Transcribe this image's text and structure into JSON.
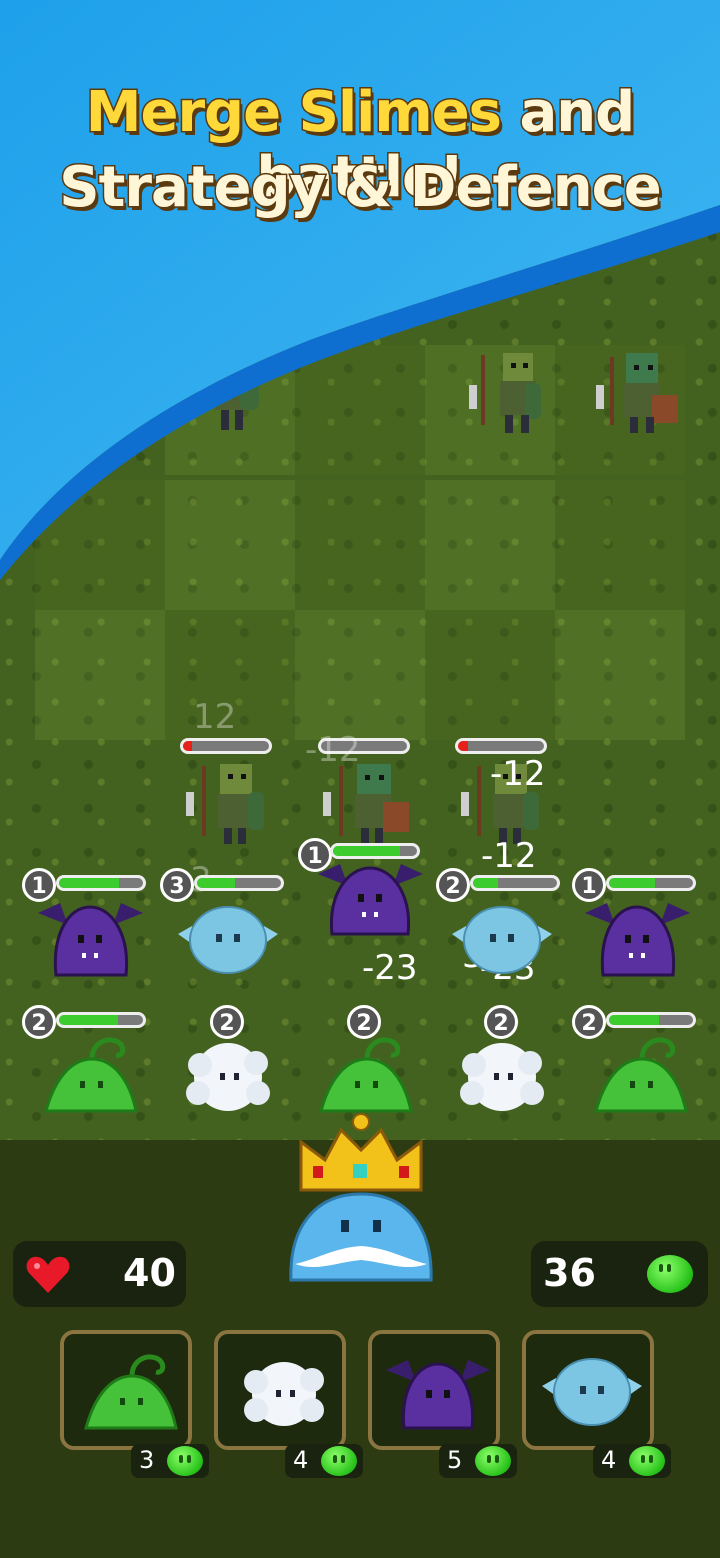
{
  "banner": {
    "headline_part1": "Merge Slimes",
    "headline_part2": "and battle!",
    "subheadline": "Strategy & Defence"
  },
  "player": {
    "lives": "40",
    "gold": "36"
  },
  "damage_numbers": [
    "12",
    "-12",
    "-12",
    "-12",
    "3",
    "-23",
    "-23",
    "3"
  ],
  "units": {
    "row1": [
      {
        "name": "bat-slime",
        "level": "1",
        "hp": 0.72
      },
      {
        "name": "ice-slime",
        "level": "3",
        "hp": 0.45
      },
      {
        "name": "bat-slime",
        "level": "1",
        "hp": 0.8
      },
      {
        "name": "ice-slime",
        "level": "2",
        "hp": 0.3
      },
      {
        "name": "bat-slime",
        "level": "1",
        "hp": 0.55
      }
    ],
    "row2": [
      {
        "name": "sprout-slime",
        "level": "2",
        "hp": 0.7
      },
      {
        "name": "fluff-slime",
        "level": "2"
      },
      {
        "name": "sprout-slime",
        "level": "2"
      },
      {
        "name": "fluff-slime",
        "level": "2"
      },
      {
        "name": "sprout-slime",
        "level": "2",
        "hp": 0.6
      }
    ]
  },
  "shop": [
    {
      "name": "sprout-slime",
      "cost": "3"
    },
    {
      "name": "fluff-slime",
      "cost": "4"
    },
    {
      "name": "bat-slime",
      "cost": "5"
    },
    {
      "name": "ice-slime",
      "cost": "4"
    }
  ],
  "colors": {
    "sky": "#29a7ec",
    "grass": "#44621f",
    "title_yellow": "#ffd93a",
    "hp_green": "#3dcc2e",
    "hp_red": "#e8201a"
  }
}
